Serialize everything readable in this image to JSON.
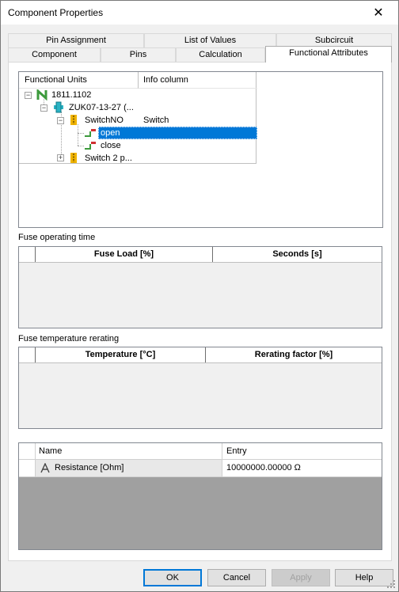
{
  "window": {
    "title": "Component Properties"
  },
  "tabs": {
    "row1": [
      "Pin Assignment",
      "List of Values",
      "Subcircuit"
    ],
    "row2": [
      "Component",
      "Pins",
      "Calculation",
      "Functional Attributes"
    ],
    "active": "Functional Attributes"
  },
  "tree": {
    "headers": [
      "Functional Units",
      "Info column"
    ],
    "nodes": [
      {
        "label": "1811.1102",
        "info": ""
      },
      {
        "label": "ZUK07-13-27 (...",
        "info": ""
      },
      {
        "label": "SwitchNO",
        "info": "Switch"
      },
      {
        "label": "open",
        "info": "",
        "selected": true
      },
      {
        "label": "close",
        "info": ""
      },
      {
        "label": "Switch 2 p...",
        "info": ""
      }
    ]
  },
  "fuse_time": {
    "label": "Fuse operating time",
    "columns": [
      "Fuse Load [%]",
      "Seconds [s]"
    ]
  },
  "fuse_temp": {
    "label": "Fuse temperature rerating",
    "columns": [
      "Temperature [°C]",
      "Rerating factor [%]"
    ]
  },
  "attributes": {
    "columns": [
      "Name",
      "Entry"
    ],
    "rows": [
      {
        "name": "Resistance [Ohm]",
        "entry": "10000000.00000 Ω"
      }
    ]
  },
  "buttons": {
    "ok": "OK",
    "cancel": "Cancel",
    "apply": "Apply",
    "help": "Help"
  },
  "colors": {
    "selection": "#0078d7",
    "gray_area": "#a0a0a0"
  }
}
